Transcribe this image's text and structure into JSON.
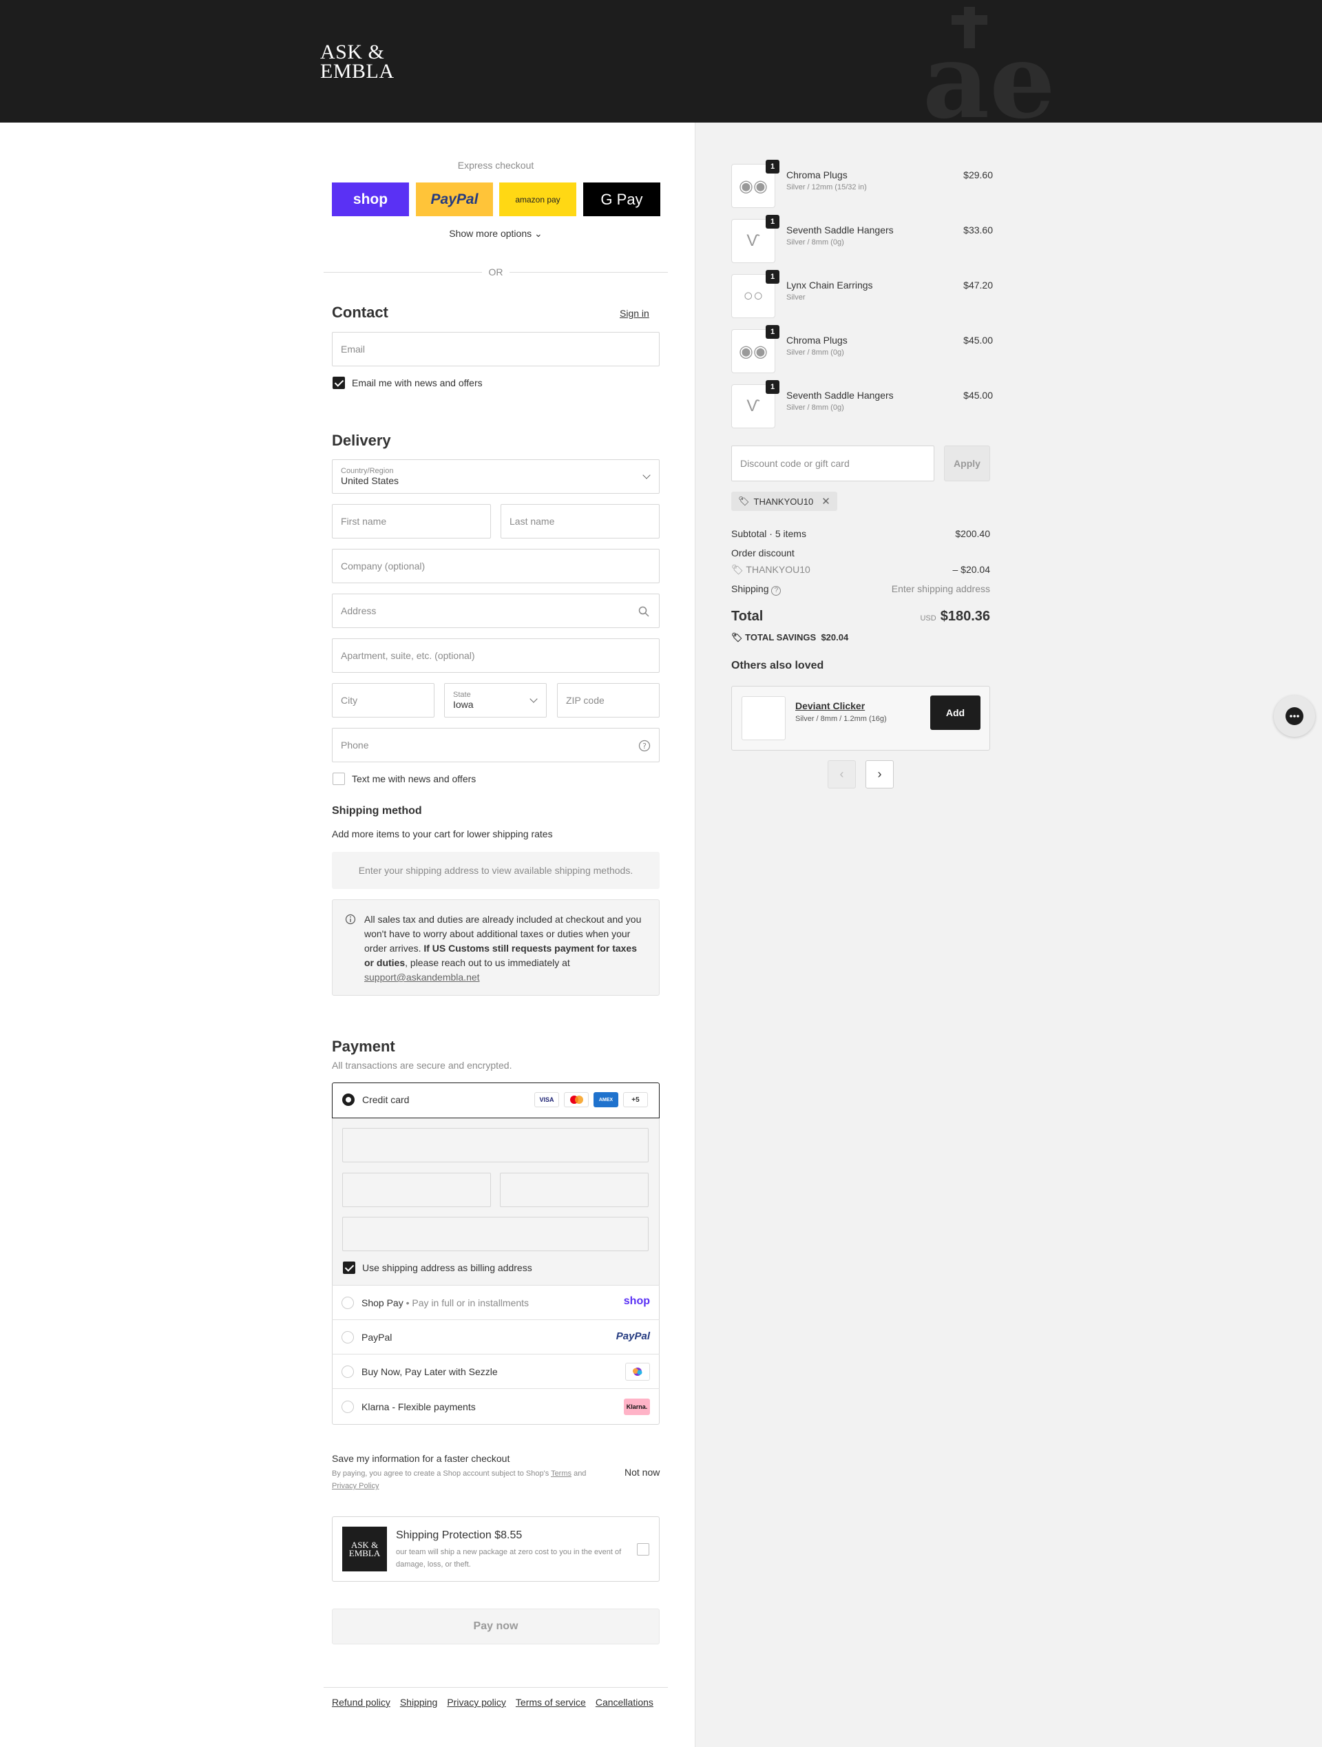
{
  "brand": {
    "line1": "ASK &",
    "line2": "EMBLA"
  },
  "express": {
    "title": "Express checkout",
    "shop": "shop",
    "paypal": "PayPal",
    "amazon": "amazon pay",
    "gpay": "G Pay",
    "more": "Show more options",
    "or": "OR"
  },
  "contact": {
    "title": "Contact",
    "signin": "Sign in",
    "email_placeholder": "Email",
    "news": "Email me with news and offers"
  },
  "delivery": {
    "title": "Delivery",
    "country_label": "Country/Region",
    "country": "United States",
    "first": "First name",
    "last": "Last name",
    "company": "Company (optional)",
    "address": "Address",
    "apt": "Apartment, suite, etc. (optional)",
    "city": "City",
    "state_label": "State",
    "state": "Iowa",
    "zip": "ZIP code",
    "phone": "Phone",
    "text_news": "Text me with news and offers"
  },
  "shipping": {
    "title": "Shipping method",
    "subtitle": "Add more items to your cart for lower shipping rates",
    "placeholder": "Enter your shipping address to view available shipping methods."
  },
  "notice": {
    "p1": "All sales tax and duties are already included at checkout and you won't have to worry about additional taxes or duties when your order arrives. ",
    "bold": "If US Customs still requests payment for taxes or duties",
    "p2": ", please reach out to us immediately at ",
    "email": "support@askandembla.net"
  },
  "payment": {
    "title": "Payment",
    "subtitle": "All transactions are secure and encrypted.",
    "credit": "Credit card",
    "more_cards": "+5",
    "billing": "Use shipping address as billing address",
    "shoppay": "Shop Pay",
    "shoppay_sub": "Pay in full or in installments",
    "shoppay_logo": "shop",
    "paypal": "PayPal",
    "paypal_logo": "PayPal",
    "sezzle": "Buy Now, Pay Later with Sezzle",
    "klarna": "Klarna - Flexible payments",
    "klarna_logo": "Klarna."
  },
  "save": {
    "title": "Save my information for a faster checkout",
    "legal1": "By paying, you agree to create a Shop account subject to Shop's ",
    "terms": "Terms",
    "and": " and ",
    "privacy": "Privacy Policy",
    "notnow": "Not now"
  },
  "protection": {
    "title": "Shipping Protection $8.55",
    "desc": "our team will ship a new package at zero cost to you in the event of damage, loss, or theft."
  },
  "paynow": "Pay now",
  "footer": [
    "Refund policy",
    "Shipping",
    "Privacy policy",
    "Terms of service",
    "Cancellations"
  ],
  "cart": {
    "items": [
      {
        "name": "Chroma Plugs",
        "variant": "Silver / 12mm (15/32 in)",
        "price": "$29.60",
        "qty": "1"
      },
      {
        "name": "Seventh Saddle Hangers",
        "variant": "Silver / 8mm (0g)",
        "price": "$33.60",
        "qty": "1"
      },
      {
        "name": "Lynx Chain Earrings",
        "variant": "Silver",
        "price": "$47.20",
        "qty": "1"
      },
      {
        "name": "Chroma Plugs",
        "variant": "Silver / 8mm (0g)",
        "price": "$45.00",
        "qty": "1"
      },
      {
        "name": "Seventh Saddle Hangers",
        "variant": "Silver / 8mm (0g)",
        "price": "$45.00",
        "qty": "1"
      }
    ],
    "discount_placeholder": "Discount code or gift card",
    "apply": "Apply",
    "code": "THANKYOU10",
    "subtotal_label": "Subtotal · 5 items",
    "subtotal": "$200.40",
    "order_discount": "Order discount",
    "discount_amount": "– $20.04",
    "shipping_label": "Shipping",
    "shipping_val": "Enter shipping address",
    "total_label": "Total",
    "currency": "USD",
    "total": "$180.36",
    "savings_label": "TOTAL SAVINGS",
    "savings": "$20.04",
    "others_title": "Others also loved",
    "rec": {
      "name": "Deviant Clicker",
      "variant": "Silver / 8mm / 1.2mm (16g)",
      "add": "Add"
    }
  }
}
